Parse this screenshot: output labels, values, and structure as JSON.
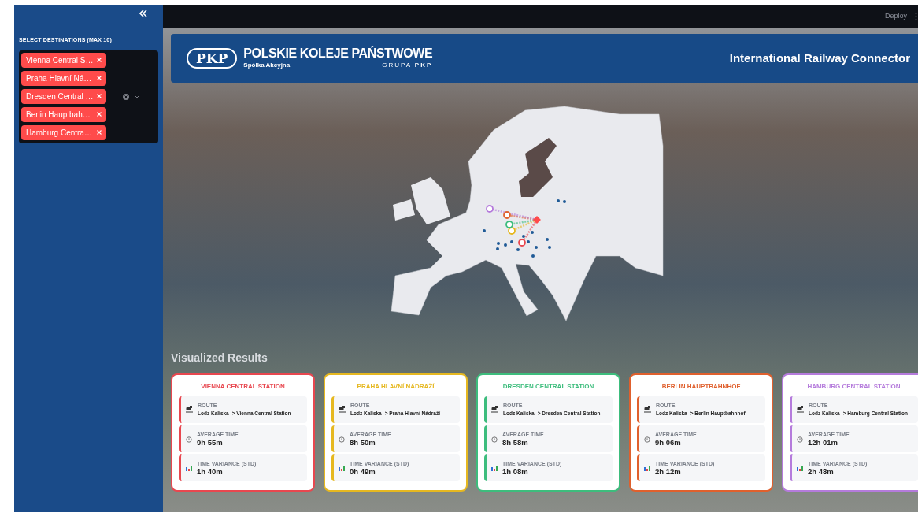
{
  "sidebar": {
    "label": "SELECT DESTINATIONS (MAX 10)",
    "tags": [
      {
        "label": "Vienna Central S…"
      },
      {
        "label": "Praha Hlavní Ná…"
      },
      {
        "label": "Dresden Central …"
      },
      {
        "label": "Berlin Hauptbah…"
      },
      {
        "label": "Hamburg Centra…"
      }
    ]
  },
  "top_bar": {
    "deploy": "Deploy"
  },
  "header": {
    "logo_mark": "PKP",
    "company": "POLSKIE KOLEJE PAŃSTWOWE",
    "subtitle": "Spółka Akcyjna",
    "group": "GRUPA **PKP**",
    "title": "International Railway Connector"
  },
  "results": {
    "heading": "Visualized Results",
    "cards": [
      {
        "title": "VIENNA CENTRAL STATION",
        "color": "#e8474f",
        "metrics": [
          {
            "kind": "route",
            "label": "ROUTE",
            "value": "Lodz Kaliska -> Vienna Central Station"
          },
          {
            "kind": "time",
            "label": "AVERAGE TIME",
            "value": "9h 55m"
          },
          {
            "kind": "variance",
            "label": "TIME VARIANCE (STD)",
            "value": "1h 40m"
          }
        ]
      },
      {
        "title": "PRAHA HLAVNÍ NÁDRAŽÍ",
        "color": "#e6b820",
        "metrics": [
          {
            "kind": "route",
            "label": "ROUTE",
            "value": "Lodz Kaliska -> Praha Hlavní Nádraží"
          },
          {
            "kind": "time",
            "label": "AVERAGE TIME",
            "value": "8h 50m"
          },
          {
            "kind": "variance",
            "label": "TIME VARIANCE (STD)",
            "value": "0h 49m"
          }
        ]
      },
      {
        "title": "DRESDEN CENTRAL STATION",
        "color": "#3dbd7d",
        "metrics": [
          {
            "kind": "route",
            "label": "ROUTE",
            "value": "Lodz Kaliska -> Dresden Central Station"
          },
          {
            "kind": "time",
            "label": "AVERAGE TIME",
            "value": "8h 58m"
          },
          {
            "kind": "variance",
            "label": "TIME VARIANCE (STD)",
            "value": "1h 08m"
          }
        ]
      },
      {
        "title": "BERLIN HAUPTBAHNHOF",
        "color": "#e0602d",
        "metrics": [
          {
            "kind": "route",
            "label": "ROUTE",
            "value": "Lodz Kaliska -> Berlin Hauptbahnhof"
          },
          {
            "kind": "time",
            "label": "AVERAGE TIME",
            "value": "9h 06m"
          },
          {
            "kind": "variance",
            "label": "TIME VARIANCE (STD)",
            "value": "2h 12m"
          }
        ]
      },
      {
        "title": "HAMBURG CENTRAL STATION",
        "color": "#b57bdc",
        "metrics": [
          {
            "kind": "route",
            "label": "ROUTE",
            "value": "Lodz Kaliska -> Hamburg Central Station"
          },
          {
            "kind": "time",
            "label": "AVERAGE TIME",
            "value": "12h 01m"
          },
          {
            "kind": "variance",
            "label": "TIME VARIANCE (STD)",
            "value": "2h 48m"
          }
        ]
      }
    ]
  }
}
